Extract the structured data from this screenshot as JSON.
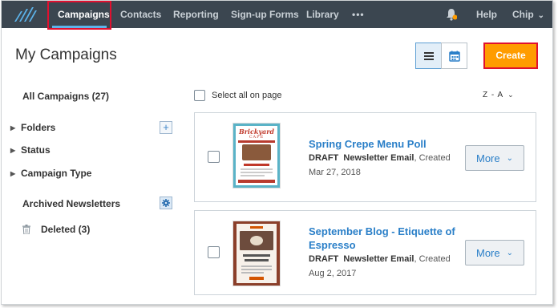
{
  "nav": {
    "items": [
      {
        "label": "Campaigns",
        "active": true
      },
      {
        "label": "Contacts"
      },
      {
        "label": "Reporting"
      },
      {
        "label": "Sign-up Forms"
      },
      {
        "label": "Library"
      },
      {
        "label": "•••"
      }
    ],
    "help": "Help",
    "user": "Chip",
    "accent": "#3b4650"
  },
  "header": {
    "title": "My Campaigns",
    "create_label": "Create"
  },
  "sidebar": {
    "all_campaigns": "All Campaigns (27)",
    "groups": [
      "Folders",
      "Status",
      "Campaign Type"
    ],
    "archived": "Archived Newsletters",
    "deleted": "Deleted (3)"
  },
  "list": {
    "select_all": "Select all on page",
    "sort": "Z - A"
  },
  "campaigns": [
    {
      "title": "Spring Crepe Menu Poll",
      "status": "DRAFT",
      "type": "Newsletter Email",
      "created_label": ", Created",
      "date": "Mar 27, 2018",
      "more": "More",
      "thumb": {
        "brand": "Brickyard",
        "sub": "CAFE"
      }
    },
    {
      "title_line1": "September Blog - Etiquette of",
      "title_line2": "Espresso",
      "status": "DRAFT",
      "type": "Newsletter Email",
      "created_label": ", Created",
      "date": "Aug 2, 2017",
      "more": "More"
    }
  ],
  "colors": {
    "create": "#ff9c00",
    "link": "#2a7fc8",
    "highlight_border": "#e0102f"
  }
}
